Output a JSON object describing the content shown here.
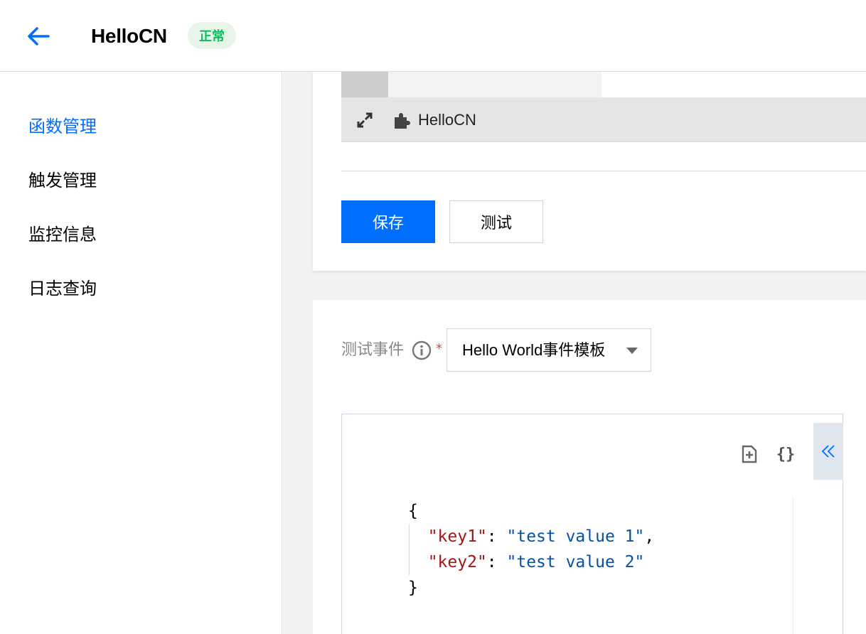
{
  "header": {
    "back_icon": "arrow-left-icon",
    "title": "HelloCN",
    "status": "正常"
  },
  "sidebar": {
    "items": [
      {
        "label": "函数管理",
        "active": true
      },
      {
        "label": "触发管理",
        "active": false
      },
      {
        "label": "监控信息",
        "active": false
      },
      {
        "label": "日志查询",
        "active": false
      }
    ]
  },
  "editor": {
    "file_name": "HelloCN",
    "expand_icon": "expand-icon",
    "function_icon": "puzzle-icon"
  },
  "actions": {
    "save_label": "保存",
    "test_label": "测试"
  },
  "test_event": {
    "label": "测试事件",
    "required_mark": "*",
    "selected": "Hello World事件模板",
    "code": {
      "open": "{",
      "lines": [
        {
          "key": "\"key1\"",
          "value": "\"test value 1\"",
          "trail": ","
        },
        {
          "key": "\"key2\"",
          "value": "\"test value 2\"",
          "trail": ""
        }
      ],
      "close": "}"
    }
  },
  "colors": {
    "accent": "#006eff",
    "status_green": "#0abf5b",
    "json_key": "#a31515",
    "json_string": "#0451a5"
  }
}
